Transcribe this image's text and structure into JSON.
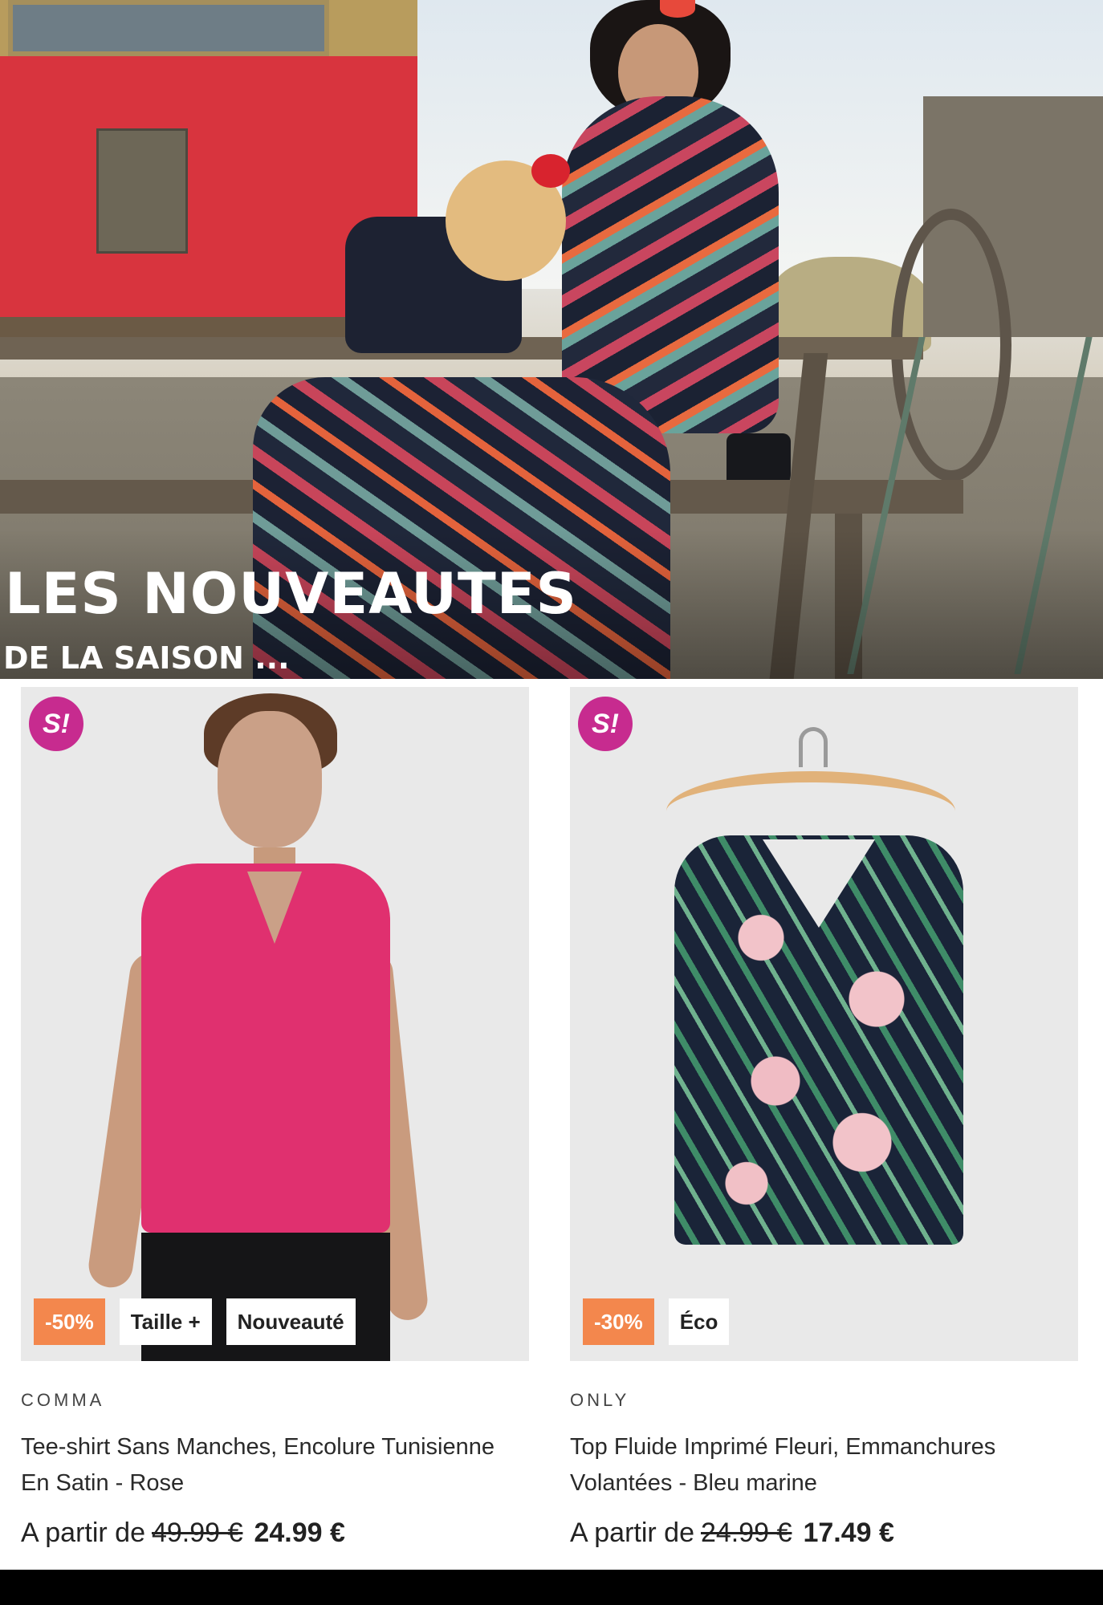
{
  "hero": {
    "title": "LES NOUVEAUTES",
    "subtitle": "DE LA SAISON ..."
  },
  "products": [
    {
      "badge": "S!",
      "tags": [
        "-50%",
        "Taille +",
        "Nouveauté"
      ],
      "brand": "COMMA",
      "title": "Tee-shirt Sans Manches, Encolure Tunisienne En Satin - Rose",
      "price_prefix": "A partir de",
      "old_price": "49.99 €",
      "new_price": "24.99 €"
    },
    {
      "badge": "S!",
      "tags": [
        "-30%",
        "Éco"
      ],
      "brand": "ONLY",
      "title": "Top Fluide Imprimé Fleuri, Emmanchures Volantées - Bleu marine",
      "price_prefix": "A partir de",
      "old_price": "24.99 €",
      "new_price": "17.49 €"
    }
  ],
  "colors": {
    "badge_s": "#c72b8f",
    "discount_tag": "#f3874d",
    "image_bg": "#e9e9e9"
  }
}
